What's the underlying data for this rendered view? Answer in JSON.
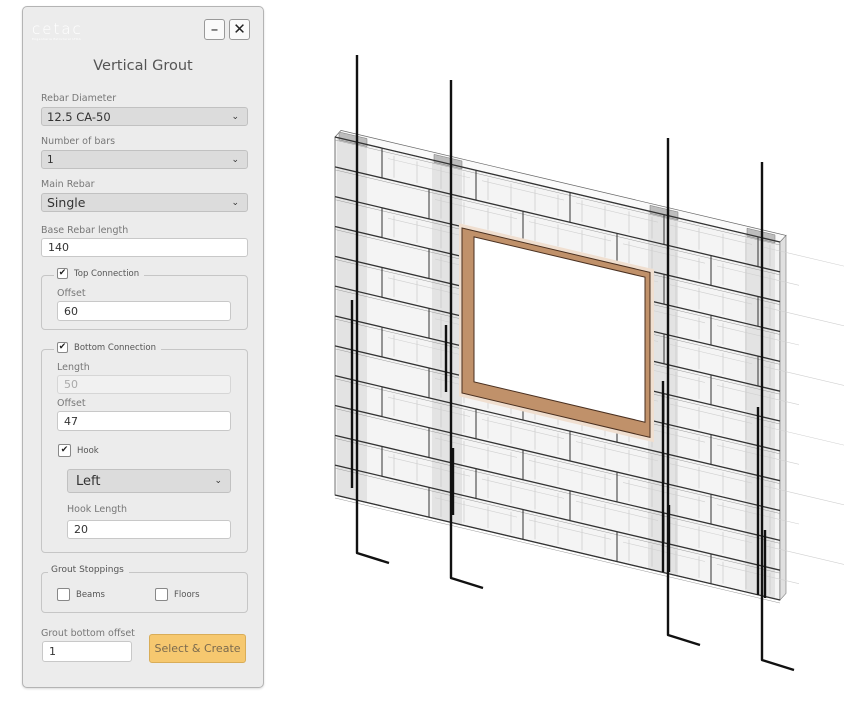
{
  "panel": {
    "logo_text": "cetac",
    "logo_subtitle": "Engenharia Estrutural LTDA",
    "window_buttons": {
      "minimize_icon": "minus-icon",
      "close_icon": "close-icon",
      "minimize_glyph": "–",
      "close_glyph": "✕"
    },
    "title": "Vertical Grout",
    "rebar_diameter": {
      "label": "Rebar Diameter",
      "value": "12.5 CA-50"
    },
    "number_of_bars": {
      "label": "Number of bars",
      "value": "1"
    },
    "main_rebar": {
      "label": "Main Rebar",
      "value": "Single"
    },
    "base_rebar_length": {
      "label": "Base Rebar length",
      "value": "140"
    },
    "top_connection": {
      "label": "Top Connection",
      "checked": true,
      "offset_label": "Offset",
      "offset_value": "60"
    },
    "bottom_connection": {
      "label": "Bottom Connection",
      "checked": true,
      "length_label": "Length",
      "length_value": "50",
      "offset_label": "Offset",
      "offset_value": "47",
      "hook": {
        "label": "Hook",
        "checked": true,
        "side": "Left",
        "length_label": "Hook Length",
        "length_value": "20"
      }
    },
    "grout_stoppings": {
      "label": "Grout Stoppings",
      "options": [
        {
          "label": "Beams",
          "checked": false
        },
        {
          "label": "Floors",
          "checked": false
        }
      ]
    },
    "grout_bottom_offset": {
      "label": "Grout bottom offset",
      "value": "1"
    },
    "submit_label": "Select & Create",
    "check_glyph": "✔",
    "chevron_glyph": "❯"
  },
  "viewport": {
    "description": "3D view of masonry block wall with window opening and vertical grout rebars",
    "colors": {
      "block_fill": "#e3e3e3",
      "block_line": "#333333",
      "window_frame": "#c0916a",
      "rebar": "#111111"
    }
  }
}
